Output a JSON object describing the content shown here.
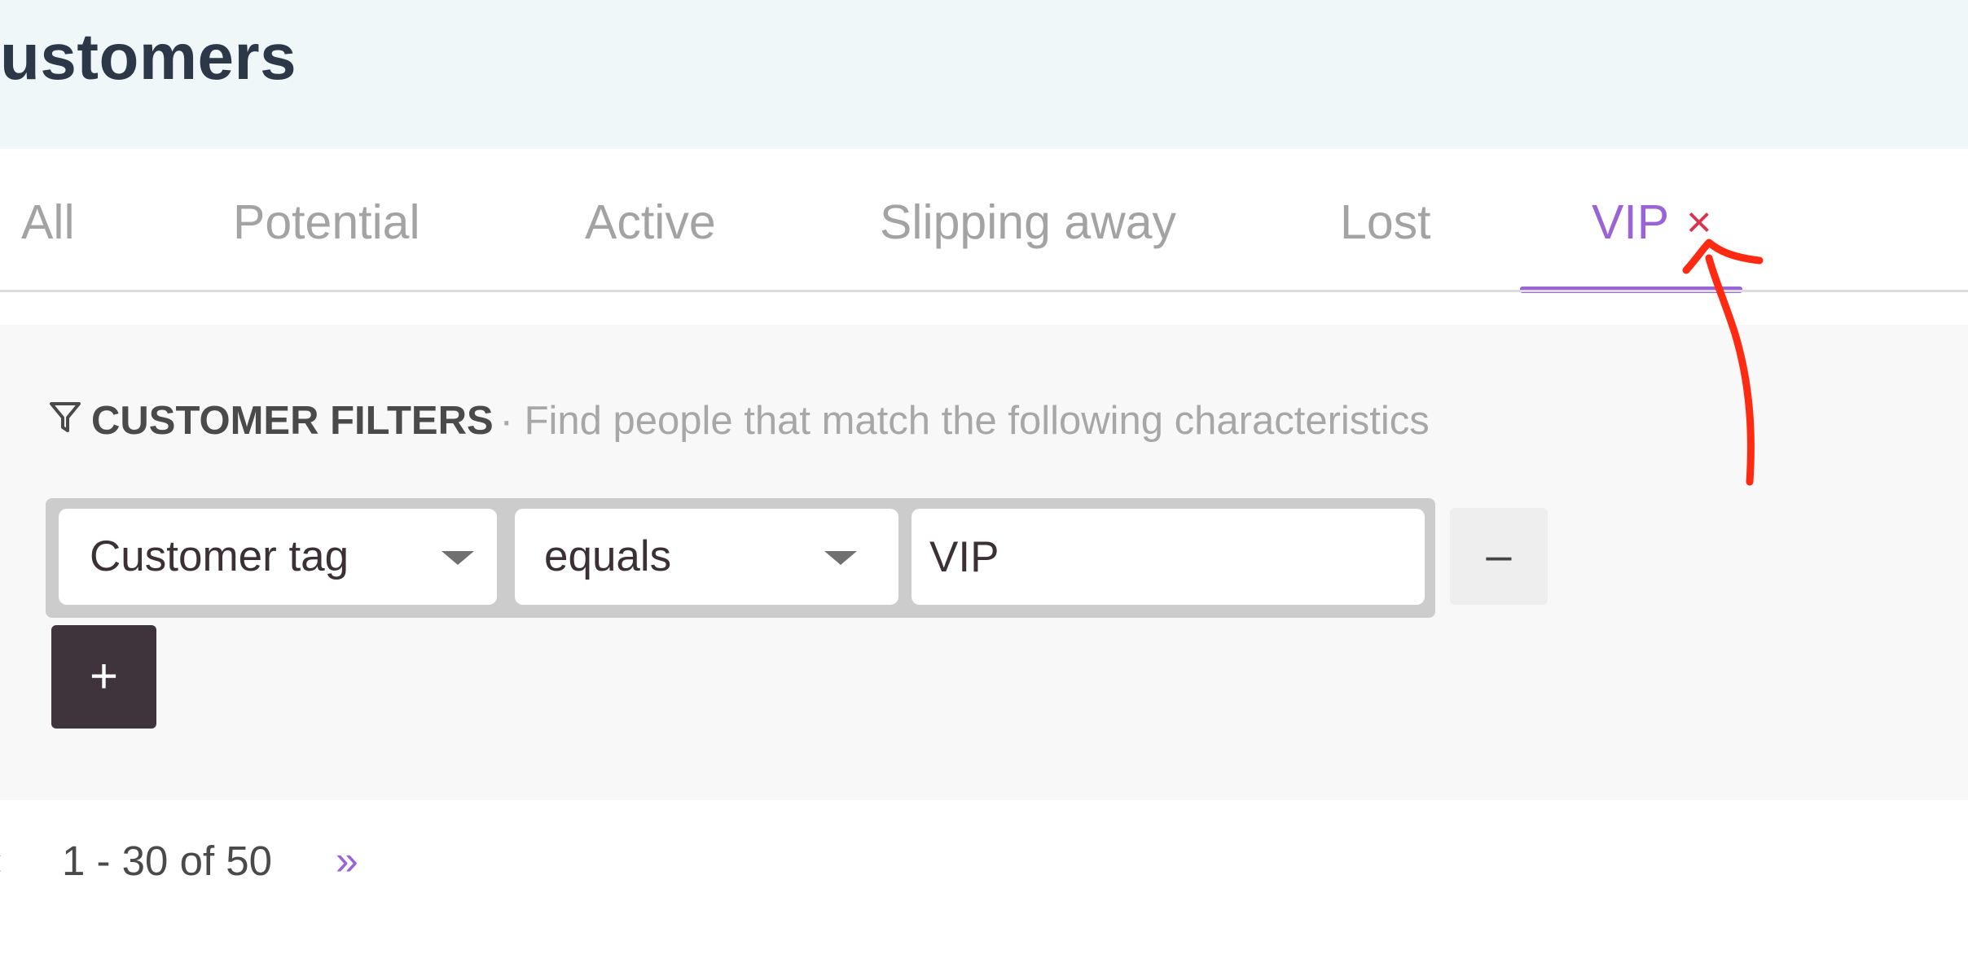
{
  "header": {
    "title": "ustomers"
  },
  "tabs": [
    {
      "label": "All",
      "active": false
    },
    {
      "label": "Potential",
      "active": false
    },
    {
      "label": "Active",
      "active": false
    },
    {
      "label": "Slipping away",
      "active": false
    },
    {
      "label": "Lost",
      "active": false
    },
    {
      "label": "VIP",
      "active": true,
      "close_glyph": "×"
    }
  ],
  "filters": {
    "icon": "filter-icon",
    "title": "CUSTOMER FILTERS",
    "description": "· Find people that match the following characteristics",
    "rows": [
      {
        "field": "Customer tag",
        "operator": "equals",
        "value": "VIP"
      }
    ],
    "remove_label": "–",
    "add_label": "+"
  },
  "pagination": {
    "prev_label": "‹",
    "range": "1 - 30 of 50",
    "next_label": "»"
  },
  "colors": {
    "accent": "#9a63d6",
    "close": "#d8344f",
    "annotation": "#ff2a12",
    "header_bg": "#f0f7f8",
    "add_button_bg": "#40343c"
  }
}
